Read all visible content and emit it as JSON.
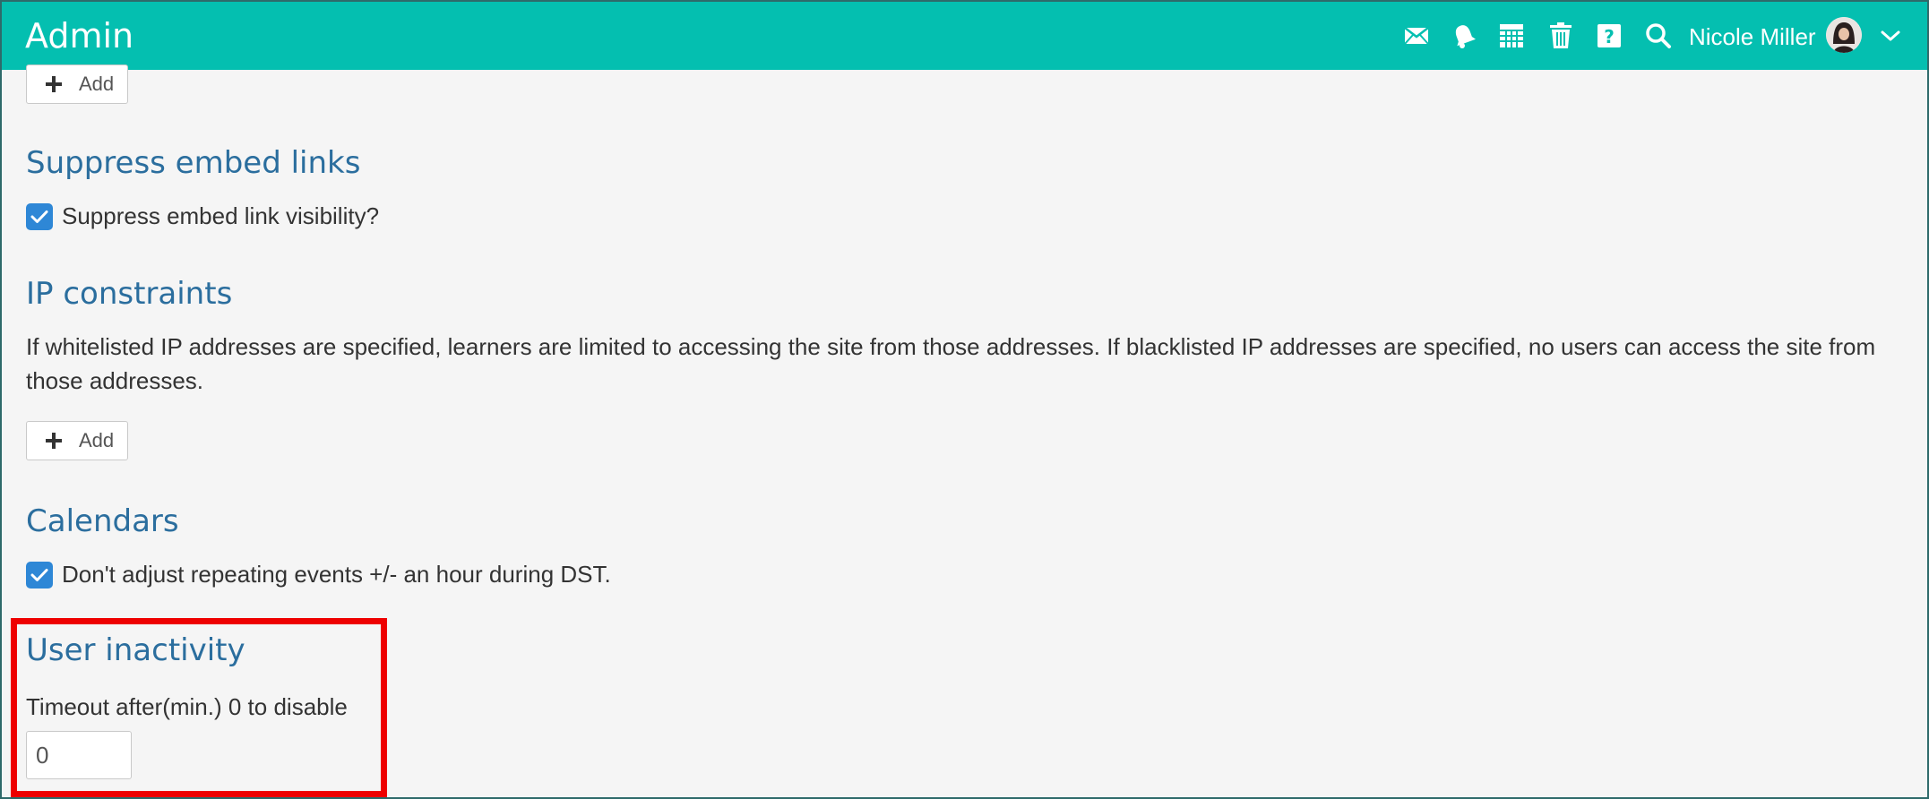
{
  "header": {
    "title": "Admin",
    "user_name": "Nicole Miller",
    "icons": [
      "mail-icon",
      "bell-icon",
      "calendar-icon",
      "trash-icon",
      "help-icon",
      "search-icon",
      "chevron-down-icon"
    ]
  },
  "sections": {
    "top_add": {
      "label": "Add"
    },
    "suppress_embed": {
      "title": "Suppress embed links",
      "checkbox_label": "Suppress embed link visibility?",
      "checked": true
    },
    "ip_constraints": {
      "title": "IP constraints",
      "description": "If whitelisted IP addresses are specified, learners are limited to accessing the site from those addresses. If blacklisted IP addresses are specified, no users can access the site from those addresses.",
      "add_label": "Add"
    },
    "calendars": {
      "title": "Calendars",
      "checkbox_label": "Don't adjust repeating events +/- an hour during DST.",
      "checked": true
    },
    "user_inactivity": {
      "title": "User inactivity",
      "field_label": "Timeout after(min.) 0 to disable",
      "value": "0"
    }
  },
  "colors": {
    "header_bg": "#04bfb0",
    "section_title": "#2b6e9e",
    "checkbox": "#2e87d6",
    "highlight": "#ee0000"
  }
}
